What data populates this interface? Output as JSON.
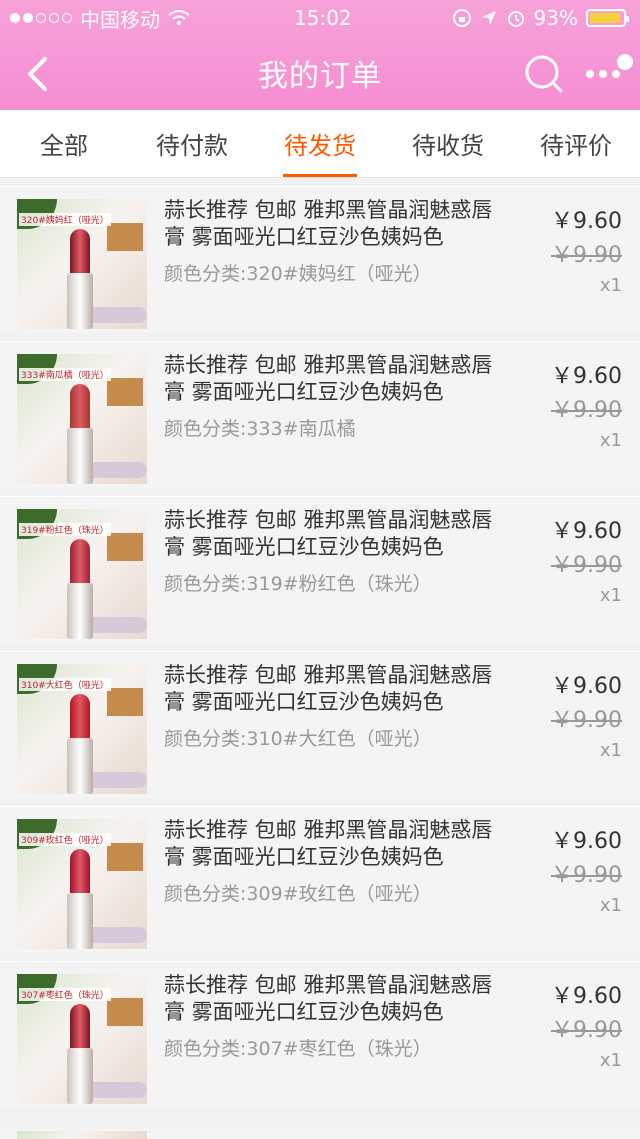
{
  "status_bar": {
    "carrier": "中国移动",
    "time": "15:02",
    "battery": "93%",
    "battery_level": 0.93
  },
  "header": {
    "title": "我的订单",
    "back_icon": "chevron-left-icon",
    "search_icon": "search-icon",
    "more_icon": "more-dots-icon"
  },
  "tabs": [
    {
      "label": "全部",
      "active": false
    },
    {
      "label": "待付款",
      "active": false
    },
    {
      "label": "待发货",
      "active": true
    },
    {
      "label": "待收货",
      "active": false
    },
    {
      "label": "待评价",
      "active": false
    }
  ],
  "orders": [
    {
      "title": "蒜长推荐 包邮 雅邦黑管晶润魅惑唇膏 雾面哑光口红豆沙色姨妈色",
      "variant": "颜色分类:320#姨妈红（哑光）",
      "price": "￥9.60",
      "original_price": "￥9.90",
      "qty": "x1",
      "thumb_label": "320#姨妈红（哑光）",
      "color": "#7a1620"
    },
    {
      "title": "蒜长推荐 包邮 雅邦黑管晶润魅惑唇膏 雾面哑光口红豆沙色姨妈色",
      "variant": "颜色分类:333#南瓜橘",
      "price": "￥9.60",
      "original_price": "￥9.90",
      "qty": "x1",
      "thumb_label": "333#南瓜橘（哑光）",
      "color": "#a23a2a"
    },
    {
      "title": "蒜长推荐 包邮 雅邦黑管晶润魅惑唇膏 雾面哑光口红豆沙色姨妈色",
      "variant": "颜色分类:319#粉红色（珠光）",
      "price": "￥9.60",
      "original_price": "￥9.90",
      "qty": "x1",
      "thumb_label": "319#粉红色（珠光）",
      "color": "#9a2436"
    },
    {
      "title": "蒜长推荐 包邮 雅邦黑管晶润魅惑唇膏 雾面哑光口红豆沙色姨妈色",
      "variant": "颜色分类:310#大红色（哑光）",
      "price": "￥9.60",
      "original_price": "￥9.90",
      "qty": "x1",
      "thumb_label": "310#大红色（哑光）",
      "color": "#b3141e"
    },
    {
      "title": "蒜长推荐 包邮 雅邦黑管晶润魅惑唇膏 雾面哑光口红豆沙色姨妈色",
      "variant": "颜色分类:309#玫红色（哑光）",
      "price": "￥9.60",
      "original_price": "￥9.90",
      "qty": "x1",
      "thumb_label": "309#玫红色（哑光）",
      "color": "#a3102e"
    },
    {
      "title": "蒜长推荐 包邮 雅邦黑管晶润魅惑唇膏 雾面哑光口红豆沙色姨妈色",
      "variant": "颜色分类:307#枣红色（珠光）",
      "price": "￥9.60",
      "original_price": "￥9.90",
      "qty": "x1",
      "thumb_label": "307#枣红色（珠光）",
      "color": "#7c1522"
    }
  ],
  "colors": {
    "header": "#f58ed3",
    "accent": "#ff5a00"
  }
}
